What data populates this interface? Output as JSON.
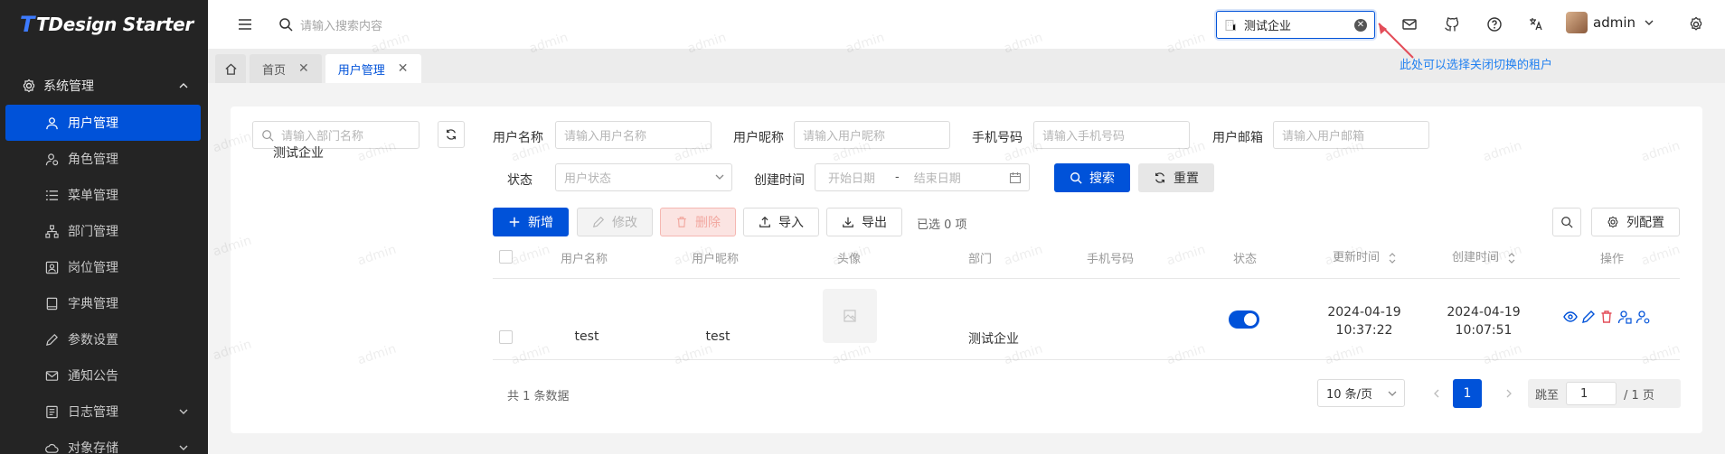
{
  "app": {
    "logo_mark": "T",
    "logo_text": "TDesign Starter"
  },
  "sidebar": {
    "group_label": "系统管理",
    "items": [
      {
        "label": "用户管理",
        "icon": "user-icon",
        "active": true
      },
      {
        "label": "角色管理",
        "icon": "user-circle-icon"
      },
      {
        "label": "菜单管理",
        "icon": "list-icon"
      },
      {
        "label": "部门管理",
        "icon": "org-icon"
      },
      {
        "label": "岗位管理",
        "icon": "badge-icon"
      },
      {
        "label": "字典管理",
        "icon": "book-icon"
      },
      {
        "label": "参数设置",
        "icon": "edit-icon"
      },
      {
        "label": "通知公告",
        "icon": "mail-icon"
      },
      {
        "label": "日志管理",
        "icon": "file-icon",
        "expandable": true
      },
      {
        "label": "对象存储",
        "icon": "cloud-icon",
        "expandable": true
      }
    ]
  },
  "header": {
    "search_placeholder": "请输入搜索内容",
    "tenant_value": "测试企业",
    "user_name": "admin"
  },
  "tabs": [
    {
      "label": "首页"
    },
    {
      "label": "用户管理",
      "active": true
    }
  ],
  "callout_text": "此处可以选择关闭切换的租户",
  "dept_tree": {
    "search_placeholder": "请输入部门名称",
    "nodes": [
      "测试企业"
    ]
  },
  "filters": {
    "username_label": "用户名称",
    "username_placeholder": "请输入用户名称",
    "nickname_label": "用户昵称",
    "nickname_placeholder": "请输入用户昵称",
    "phone_label": "手机号码",
    "phone_placeholder": "请输入手机号码",
    "email_label": "用户邮箱",
    "email_placeholder": "请输入用户邮箱",
    "status_label": "状态",
    "status_placeholder": "用户状态",
    "created_label": "创建时间",
    "start_placeholder": "开始日期",
    "range_sep": "-",
    "end_placeholder": "结束日期",
    "search_button": "搜索",
    "reset_button": "重置"
  },
  "toolbar": {
    "add": "新增",
    "edit": "修改",
    "delete": "删除",
    "import": "导入",
    "export": "导出",
    "selected_text": "已选 0 项",
    "column_config": "列配置"
  },
  "table": {
    "columns": [
      "用户名称",
      "用户昵称",
      "头像",
      "部门",
      "手机号码",
      "状态",
      "更新时间",
      "创建时间",
      "操作"
    ],
    "rows": [
      {
        "username": "test",
        "nickname": "test",
        "dept": "测试企业",
        "phone": "",
        "status_on": true,
        "updated_date": "2024-04-19",
        "updated_time": "10:37:22",
        "created_date": "2024-04-19",
        "created_time": "10:07:51"
      }
    ]
  },
  "pagination": {
    "total_text": "共 1 条数据",
    "page_size": "10 条/页",
    "current_page": "1",
    "jump_label": "跳至",
    "jump_value": "1",
    "total_pages": "/ 1 页"
  },
  "watermark_text": "admin",
  "colors": {
    "primary": "#0052d9",
    "sidebar_bg": "#242424",
    "callout": "#2080f0",
    "danger": "#e34d59"
  }
}
